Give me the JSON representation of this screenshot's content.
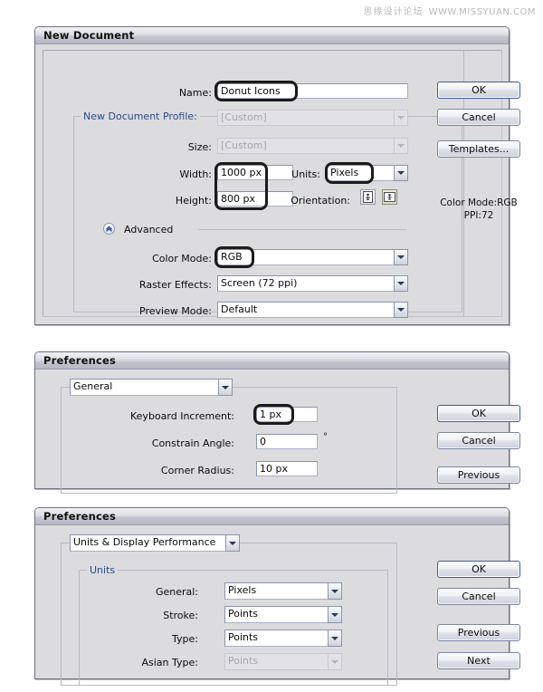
{
  "watermark": {
    "cn": "思缘设计论坛",
    "url": "WWW.MISSYUAN.COM"
  },
  "new_document_dialog": {
    "title": "New Document",
    "fields": {
      "name_label": "Name:",
      "name_value": "Donut Icons",
      "profile_label": "New Document Profile:",
      "profile_value": "[Custom]",
      "size_label": "Size:",
      "size_value": "[Custom]",
      "width_label": "Width:",
      "width_value": "1000 px",
      "height_label": "Height:",
      "height_value": "800 px",
      "units_label": "Units:",
      "units_value": "Pixels",
      "orientation_label": "Orientation:",
      "advanced_label": "Advanced",
      "color_mode_label": "Color Mode:",
      "color_mode_value": "RGB",
      "raster_effects_label": "Raster Effects:",
      "raster_effects_value": "Screen (72 ppi)",
      "preview_mode_label": "Preview Mode:",
      "preview_mode_value": "Default"
    },
    "buttons": {
      "ok": "OK",
      "cancel": "Cancel",
      "templates": "Templates..."
    },
    "info": {
      "color_mode": "Color Mode:RGB",
      "ppi": "PPI:72"
    }
  },
  "preferences_general_dialog": {
    "title": "Preferences",
    "section_value": "General",
    "fields": {
      "keyboard_increment_label": "Keyboard Increment:",
      "keyboard_increment_value": "1 px",
      "constrain_angle_label": "Constrain Angle:",
      "constrain_angle_value": "0",
      "degree_symbol": "°",
      "corner_radius_label": "Corner Radius:",
      "corner_radius_value": "10 px"
    },
    "buttons": {
      "ok": "OK",
      "cancel": "Cancel",
      "previous": "Previous"
    }
  },
  "preferences_units_dialog": {
    "title": "Preferences",
    "section_value": "Units & Display Performance",
    "group_title": "Units",
    "fields": {
      "general_label": "General:",
      "general_value": "Pixels",
      "stroke_label": "Stroke:",
      "stroke_value": "Points",
      "type_label": "Type:",
      "type_value": "Points",
      "asian_type_label": "Asian Type:",
      "asian_type_value": "Points"
    },
    "buttons": {
      "ok": "OK",
      "cancel": "Cancel",
      "previous": "Previous",
      "next": "Next"
    }
  },
  "colors": {
    "dialog_bg": "#dcdcdf",
    "accent_blue": "#2c4a86",
    "highlight_ring": "#1b1b1b"
  }
}
